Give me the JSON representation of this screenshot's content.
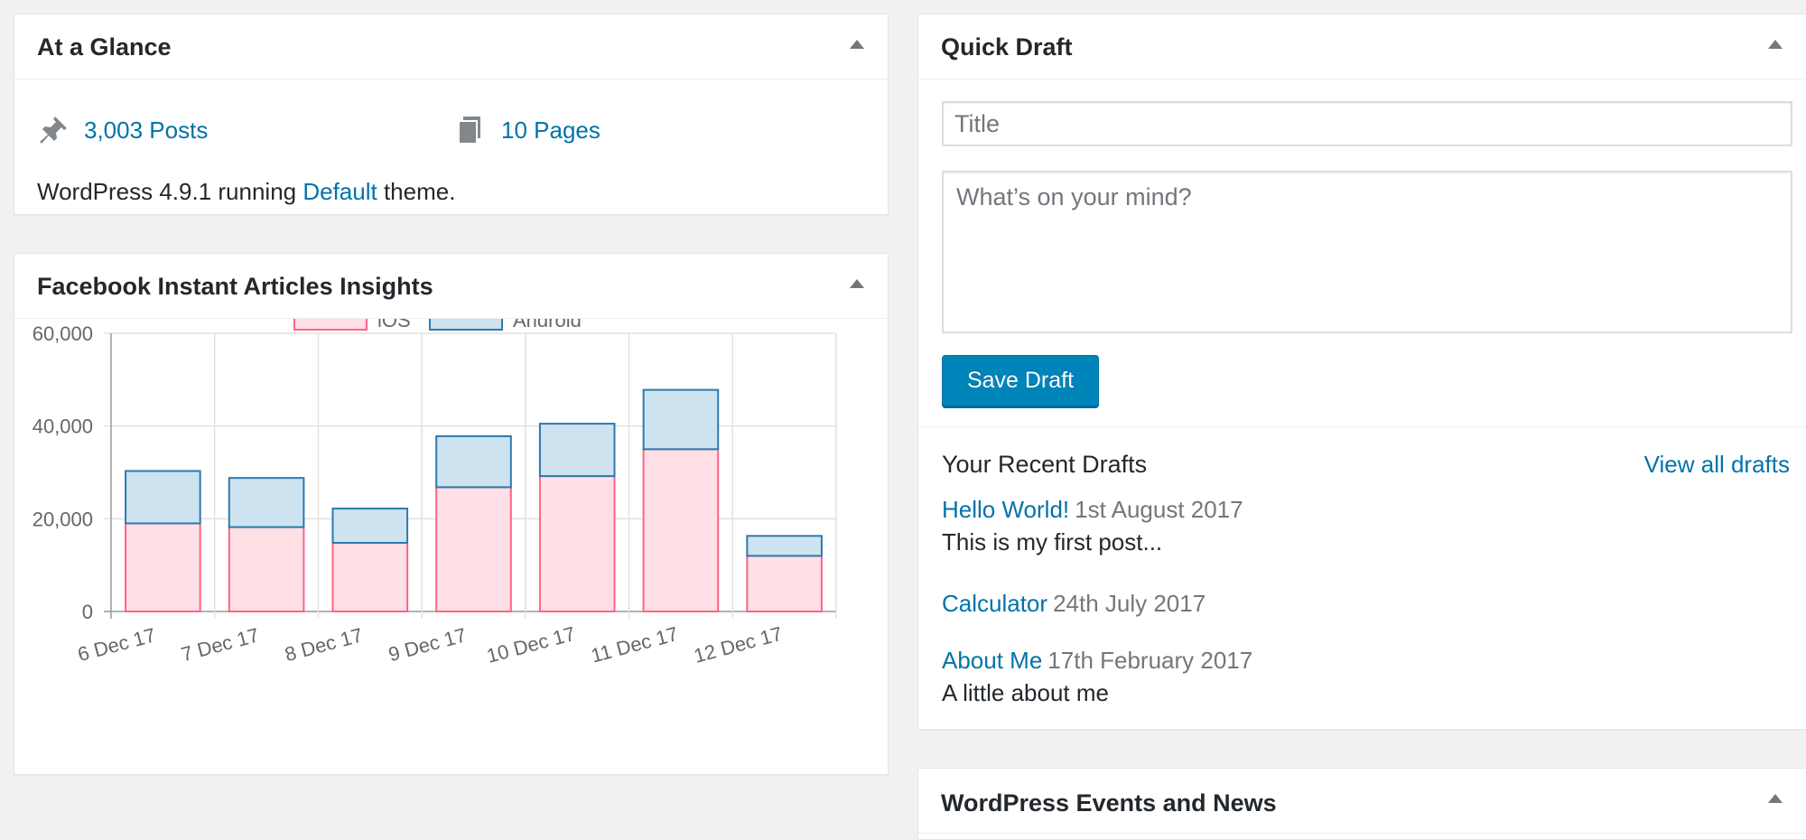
{
  "at_a_glance": {
    "title": "At a Glance",
    "posts": "3,003 Posts",
    "pages": "10 Pages",
    "version_prefix": "WordPress 4.9.1 running ",
    "theme_link": "Default",
    "version_suffix": " theme."
  },
  "fb_insights": {
    "title": "Facebook Instant Articles Insights"
  },
  "chart_data": {
    "type": "bar",
    "stacked": true,
    "categories": [
      "6 Dec 17",
      "7 Dec 17",
      "8 Dec 17",
      "9 Dec 17",
      "10 Dec 17",
      "11 Dec 17",
      "12 Dec 17"
    ],
    "series": [
      {
        "name": "iOS",
        "values": [
          19000,
          18200,
          14800,
          26800,
          29200,
          35000,
          12000
        ],
        "fill": "#ffe0e6",
        "stroke": "#ff6384"
      },
      {
        "name": "Android",
        "values": [
          11300,
          10600,
          7400,
          11000,
          11300,
          12800,
          4300
        ],
        "fill": "#cde3ef",
        "stroke": "#2c7aaf"
      }
    ],
    "yticks": [
      "0",
      "20,000",
      "40,000",
      "60,000"
    ],
    "ylim": [
      0,
      60000
    ],
    "grid": true,
    "legend_position": "top"
  },
  "quick_draft": {
    "title": "Quick Draft",
    "title_placeholder": "Title",
    "content_placeholder": "What’s on your mind?",
    "save_label": "Save Draft",
    "recent_heading": "Your Recent Drafts",
    "view_all": "View all drafts",
    "drafts": [
      {
        "title": "Hello World!",
        "date": "1st August 2017",
        "excerpt": "This is my first post..."
      },
      {
        "title": "Calculator",
        "date": "24th July 2017",
        "excerpt": ""
      },
      {
        "title": "About Me",
        "date": "17th February 2017",
        "excerpt": "A little about me"
      }
    ]
  },
  "events": {
    "title": "WordPress Events and News"
  },
  "colors": {
    "link": "#0073aa",
    "primary_button": "#0085ba",
    "background": "#f1f1f1"
  }
}
